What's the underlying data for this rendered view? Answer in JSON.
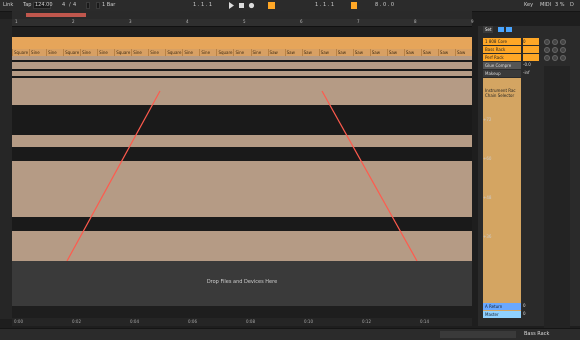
{
  "transport": {
    "link": "Link",
    "tap": "Tap",
    "tempo": "124.00",
    "sig_num": "4",
    "sig_den": "4",
    "quantize": "1 Bar",
    "position": "1 . 1 . 1",
    "loop_start": "1 . 1 . 1",
    "loop_len": "8 . 0 . 0",
    "key": "Key",
    "midi": "MIDI",
    "cpu": "3 %",
    "d": "D"
  },
  "ruler": {
    "marks": [
      "1",
      "2",
      "3",
      "4",
      "5",
      "6",
      "7",
      "8",
      "9"
    ]
  },
  "clip_names": [
    "Square",
    "Sine",
    "Sine",
    "Square",
    "Sine",
    "Sine",
    "Square",
    "Sine",
    "Sine",
    "Square",
    "Sine",
    "Sine",
    "Square",
    "Sine",
    "Sine",
    "Saw",
    "Saw",
    "Saw",
    "Saw",
    "Saw",
    "Saw",
    "Saw",
    "Saw",
    "Saw",
    "Saw",
    "Saw",
    "Saw"
  ],
  "drop_text": "Drop Files and Devices Here",
  "right_panel": {
    "set_label": "Set",
    "tracks": [
      {
        "name": "1 808 Core",
        "color": "#ffa726"
      },
      {
        "name": "Bass Rack",
        "color": "#ffa726"
      },
      {
        "name": "Perf Rack",
        "color": "#ffa726"
      },
      {
        "name": "Glue Compre",
        "color": "#555555"
      }
    ],
    "makeup": "Makeup",
    "makeup_val": "-inf",
    "device_title": "Instrument Rac Chain Selector",
    "scale_labels": [
      "+72",
      "+60",
      "+48",
      "+36"
    ],
    "val_a": "0",
    "val_b": "-0.0",
    "returns": [
      {
        "name": "A Return",
        "val": "0"
      },
      {
        "name": "Master",
        "val": "0"
      }
    ]
  },
  "bottom_ruler": {
    "labels": [
      "0:00",
      "0:02",
      "0:04",
      "0:06",
      "0:08",
      "0:10",
      "0:12",
      "0:14"
    ]
  },
  "status": {
    "track": "Bass Rack"
  },
  "colors": {
    "clip": "#e6a55a",
    "lane": "#b59b85",
    "dark": "#1a1a1a",
    "accent": "#ffa726",
    "automation": "#ff5a4d"
  }
}
